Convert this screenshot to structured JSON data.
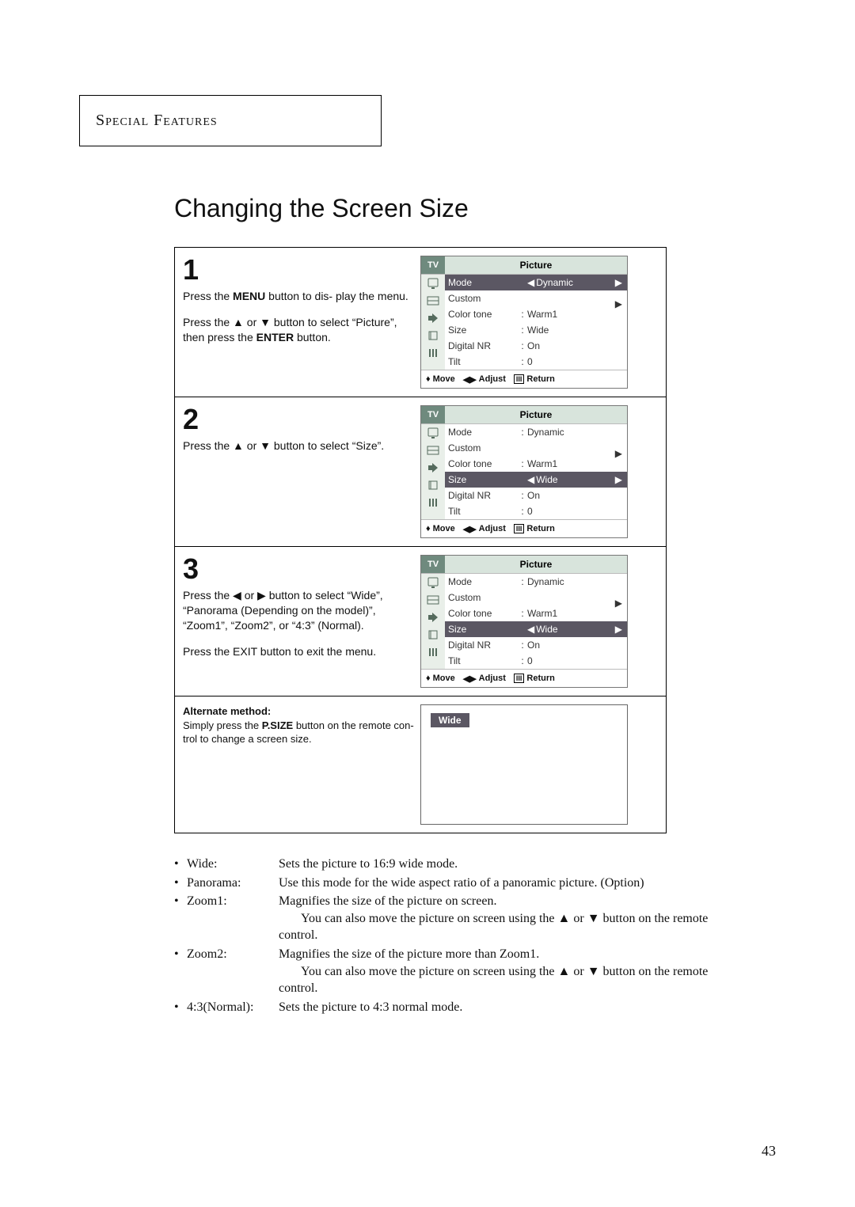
{
  "section_header": "Special Features",
  "page_title": "Changing the Screen Size",
  "osd": {
    "tab": "TV",
    "menu_title": "Picture",
    "rows": {
      "mode": {
        "label": "Mode",
        "value": "Dynamic"
      },
      "custom": {
        "label": "Custom",
        "value": ""
      },
      "colortone": {
        "label": "Color tone",
        "value": "Warm1"
      },
      "size": {
        "label": "Size",
        "value": "Wide"
      },
      "digitalnr": {
        "label": "Digital NR",
        "value": "On"
      },
      "tilt": {
        "label": "Tilt",
        "value": "0"
      }
    },
    "footer": {
      "move": "Move",
      "adjust": "Adjust",
      "return": "Return"
    }
  },
  "steps": {
    "s1": {
      "num": "1",
      "p1a": "Press the ",
      "p1b": "MENU",
      "p1c": " button to dis-\nplay the menu.",
      "p2a": "Press the ",
      "p2b": " or ",
      "p2c": " button to select “Picture”, then press the ",
      "p2d": "ENTER",
      "p2e": " button."
    },
    "s2": {
      "num": "2",
      "p1a": "Press the ",
      "p1b": " or ",
      "p1c": " button to select “Size”."
    },
    "s3": {
      "num": "3",
      "p1a": "Press the ",
      "p1b": " or ",
      "p1c": " button to select “Wide”, “Panorama (Depending on the model)”, “Zoom1”, “Zoom2”, or “4:3” (Normal).",
      "p2": "Press the EXIT button to exit the menu."
    },
    "alt": {
      "head": "Alternate method:",
      "body1": "Simply press the ",
      "body1b": "P.SIZE",
      "body2": " button on the remote con-\ntrol to change a screen size.",
      "pill": "Wide"
    }
  },
  "definitions": {
    "wide": {
      "term": "Wide:",
      "desc": "Sets the picture to 16:9 wide mode."
    },
    "panorama": {
      "term": "Panorama:",
      "desc": "Use this mode for the wide aspect ratio of a panoramic picture. (Option)"
    },
    "zoom1": {
      "term": "Zoom1:",
      "desc1": "Magnifies the size of the picture on screen.",
      "desc2a": "You can also move the picture on screen using the ",
      "desc2b": " or ",
      "desc2c": " button on the remote control."
    },
    "zoom2": {
      "term": "Zoom2:",
      "desc1": "Magnifies the size of the picture more than Zoom1.",
      "desc2a": "You can also move the picture on screen using the ",
      "desc2b": " or ",
      "desc2c": " button on the remote control."
    },
    "normal": {
      "term": "4:3(Normal):",
      "desc": "Sets the picture to 4:3 normal mode."
    }
  },
  "page_number": "43"
}
